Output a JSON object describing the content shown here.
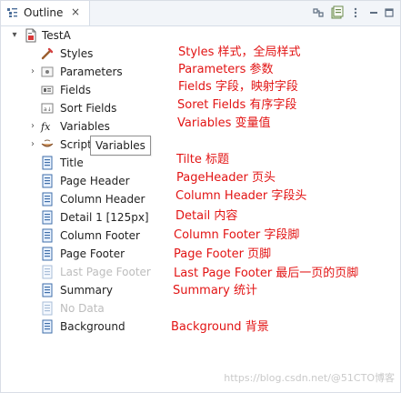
{
  "panel": {
    "title": "Outline",
    "close_glyph": "×"
  },
  "toolbar": {
    "icons": [
      "collapse-all-icon",
      "view-menu-icon"
    ]
  },
  "tree": {
    "root": {
      "label": "TestA",
      "expanded": true,
      "icon": "report-icon"
    },
    "items": [
      {
        "label": "Styles",
        "icon": "styles-icon",
        "expandable": false,
        "disabled": false
      },
      {
        "label": "Parameters",
        "icon": "parameters-icon",
        "expandable": true,
        "disabled": false
      },
      {
        "label": "Fields",
        "icon": "fields-icon",
        "expandable": false,
        "disabled": false
      },
      {
        "label": "Sort Fields",
        "icon": "sort-fields-icon",
        "expandable": false,
        "disabled": false
      },
      {
        "label": "Variables",
        "icon": "variables-icon",
        "expandable": true,
        "disabled": false
      },
      {
        "label": "Scriptlets",
        "icon": "scriptlets-icon",
        "expandable": true,
        "disabled": false
      },
      {
        "label": "Title",
        "icon": "band-icon",
        "expandable": false,
        "disabled": false
      },
      {
        "label": "Page Header",
        "icon": "band-icon",
        "expandable": false,
        "disabled": false
      },
      {
        "label": "Column Header",
        "icon": "band-icon",
        "expandable": false,
        "disabled": false
      },
      {
        "label": "Detail 1 [125px]",
        "icon": "band-icon",
        "expandable": false,
        "disabled": false
      },
      {
        "label": "Column Footer",
        "icon": "band-icon",
        "expandable": false,
        "disabled": false
      },
      {
        "label": "Page Footer",
        "icon": "band-icon",
        "expandable": false,
        "disabled": false
      },
      {
        "label": "Last Page Footer",
        "icon": "band-icon",
        "expandable": false,
        "disabled": true
      },
      {
        "label": "Summary",
        "icon": "band-icon",
        "expandable": false,
        "disabled": false
      },
      {
        "label": "No Data",
        "icon": "band-icon",
        "expandable": false,
        "disabled": true
      },
      {
        "label": "Background",
        "icon": "band-icon",
        "expandable": false,
        "disabled": false
      }
    ]
  },
  "tooltip": {
    "text": "Variables"
  },
  "annotations": [
    "Styles 样式，全局样式",
    "Parameters 参数",
    "Fields 字段，映射字段",
    "Soret Fields 有序字段",
    "Variables 变量值",
    "Tilte 标题",
    "PageHeader 页头",
    "Column Header 字段头",
    "Detail  内容",
    "Column Footer 字段脚",
    "Page Footer 页脚",
    "Last Page Footer 最后一页的页脚",
    "Summary 统计",
    "Background 背景"
  ],
  "watermark": "https://blog.csdn.net/@51CTO博客",
  "colors": {
    "annotation": "#e21414",
    "disabled": "#bdbdbd",
    "tab_background": "#f2f5f9"
  }
}
